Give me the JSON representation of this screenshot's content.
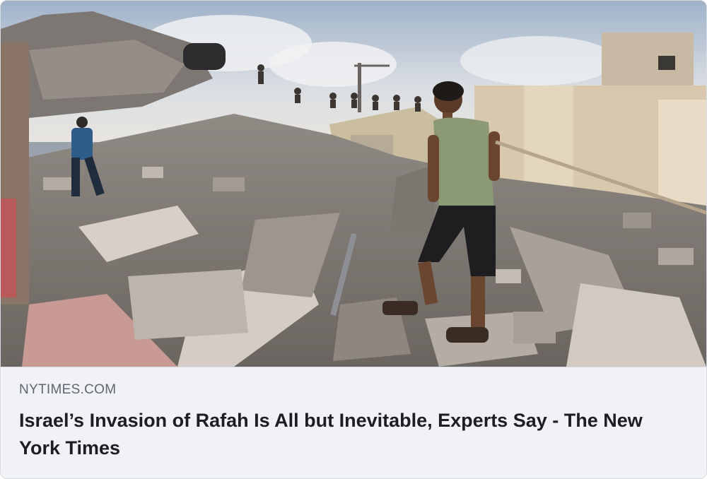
{
  "link_preview": {
    "domain": "NYTIMES.COM",
    "title": "Israel’s Invasion of Rafah Is All but Inevitable, Experts Say - The New York Times",
    "image_alt": "",
    "colors": {
      "card_background": "#f0f2f5",
      "domain_text": "#606770",
      "title_text": "#1c1e21",
      "border": "#d6dbe1"
    }
  }
}
